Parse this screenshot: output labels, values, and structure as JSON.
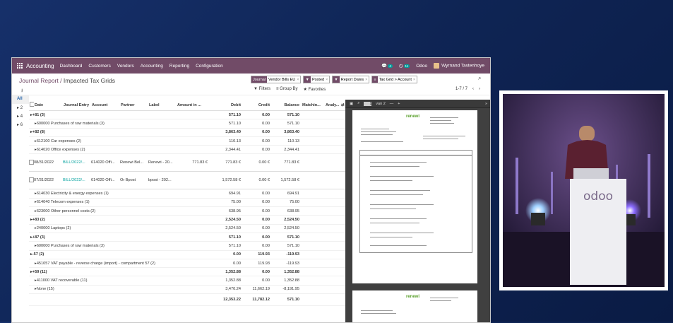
{
  "navbar": {
    "app": "Accounting",
    "menu": [
      "Dashboard",
      "Customers",
      "Vendors",
      "Accounting",
      "Reporting",
      "Configuration"
    ],
    "chat_badge": "4",
    "activity_badge": "11",
    "company": "Odoo",
    "user": "Wyrnand Tastenhoye"
  },
  "breadcrumb": {
    "parent": "Journal Report",
    "current": "Impacted Tax Grids"
  },
  "facets": [
    {
      "key": "Journal",
      "value": "Vendor Bills EU"
    },
    {
      "key": "",
      "value": "Posted"
    },
    {
      "key": "",
      "value": "Report Dates"
    },
    {
      "key": "",
      "value": "Tax Grid > Account"
    }
  ],
  "toolbar": {
    "filters": "Filters",
    "group_by": "Group By",
    "favorites": "Favorites"
  },
  "pager": {
    "value": "1-7 / 7"
  },
  "side_panel": [
    "All",
    "2",
    "4",
    "6"
  ],
  "columns": [
    "Date",
    "Journal Entry",
    "Account",
    "Partner",
    "Label",
    "Amount in ...",
    "Debit",
    "Credit",
    "Balance",
    "Matchin...",
    "Analy..."
  ],
  "rows": [
    {
      "kind": "g1",
      "group": "+81 (3)",
      "debit": "571.10",
      "credit": "0.00",
      "balance": "571.10"
    },
    {
      "kind": "g2",
      "group": "600000 Purchases of raw materials (3)",
      "debit": "571.10",
      "credit": "0.00",
      "balance": "571.10"
    },
    {
      "kind": "g1",
      "group": "+82 (8)",
      "debit": "3,863.40",
      "credit": "0.00",
      "balance": "3,863.40"
    },
    {
      "kind": "g2",
      "group": "612100 Car expenses (2)",
      "debit": "110.13",
      "credit": "0.00",
      "balance": "110.13"
    },
    {
      "kind": "g2",
      "group": "614020 Office expenses (2)",
      "debit": "2,344.41",
      "credit": "0.00",
      "balance": "2,344.41"
    },
    {
      "kind": "rec",
      "date": "08/31/2022",
      "journal": "BILL/2022/...",
      "account": "614020 Offi...",
      "partner": "Renewi Bel...",
      "label": "Renewi - 20...",
      "amount": "771.83 €",
      "debit": "771.83 €",
      "credit": "0.00 €",
      "balance": "771.83 €"
    },
    {
      "kind": "rec",
      "date": "07/31/2022",
      "journal": "BILL/2022/...",
      "account": "614020 Offi...",
      "partner": "Or Bpost",
      "label": "bpost - 202...",
      "amount": "",
      "debit": "1,572.58 €",
      "credit": "0.00 €",
      "balance": "1,572.58 €"
    },
    {
      "kind": "g2",
      "group": "614030 Electricity & energy expenses (1)",
      "debit": "694.91",
      "credit": "0.00",
      "balance": "694.91"
    },
    {
      "kind": "g2",
      "group": "614040 Telecom expenses (1)",
      "debit": "75.00",
      "credit": "0.00",
      "balance": "75.00"
    },
    {
      "kind": "g2",
      "group": "623000 Other personnel costs (2)",
      "debit": "638.95",
      "credit": "0.00",
      "balance": "638.95"
    },
    {
      "kind": "g1",
      "group": "+83 (2)",
      "debit": "2,524.50",
      "credit": "0.00",
      "balance": "2,524.50"
    },
    {
      "kind": "g2",
      "group": "240000 Laptops (2)",
      "debit": "2,524.50",
      "credit": "0.00",
      "balance": "2,524.50"
    },
    {
      "kind": "g1",
      "group": "+87 (3)",
      "debit": "571.10",
      "credit": "0.00",
      "balance": "571.10"
    },
    {
      "kind": "g2",
      "group": "600000 Purchases of raw materials (3)",
      "debit": "571.10",
      "credit": "0.00",
      "balance": "571.10"
    },
    {
      "kind": "g1",
      "group": "-57 (2)",
      "debit": "0.00",
      "credit": "119.93",
      "balance": "-119.93"
    },
    {
      "kind": "g2",
      "group": "451057 VAT payable - reverse charge (import) - compartment 57 (2)",
      "debit": "0.00",
      "credit": "119.93",
      "balance": "-119.93"
    },
    {
      "kind": "g1",
      "group": "+59 (11)",
      "debit": "1,352.88",
      "credit": "0.00",
      "balance": "1,352.88"
    },
    {
      "kind": "g2",
      "group": "411000 VAT recoverable (11)",
      "debit": "1,352.88",
      "credit": "0.00",
      "balance": "1,352.88"
    },
    {
      "kind": "g3",
      "group": "None (15)",
      "debit": "3,470.24",
      "credit": "11,662.19",
      "balance": "-8,191.95"
    }
  ],
  "totals": {
    "debit": "12,353.22",
    "credit": "11,782.12",
    "balance": "571.10"
  },
  "viewer": {
    "page": "1",
    "of": "van 2"
  },
  "invoice": {
    "logo_a": "ren",
    "logo_b": "ewi"
  }
}
